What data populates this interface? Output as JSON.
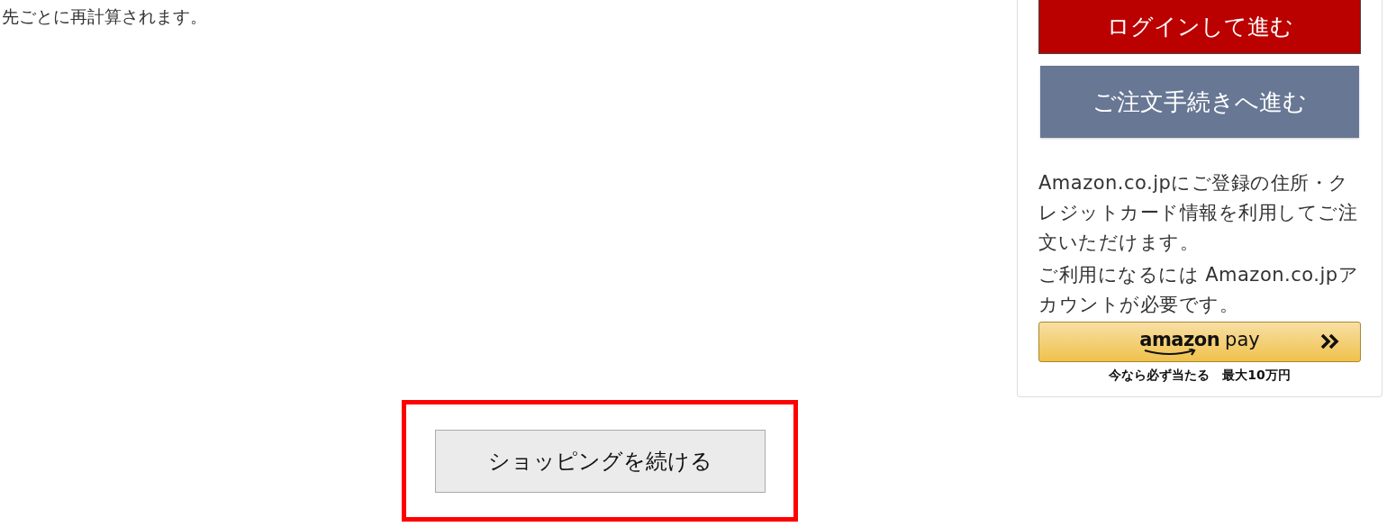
{
  "note": "先ごとに再計算されます。",
  "checkout_panel": {
    "login_button": "ログインして進む",
    "checkout_button": "ご注文手続きへ進む",
    "info_lines": [
      "Amazon.co.jpにご登録の住所・クレジットカード情報を利用してご注文いただけます。",
      "ご利用になるには Amazon.co.jpアカウントが必要です。"
    ],
    "amazon_pay": {
      "logo_left": "amazon",
      "logo_right": "pay",
      "caption": "今なら必ず当たる　最大10万円"
    }
  },
  "continue_shopping": {
    "label": "ショッピングを続ける",
    "highlighted": true
  }
}
